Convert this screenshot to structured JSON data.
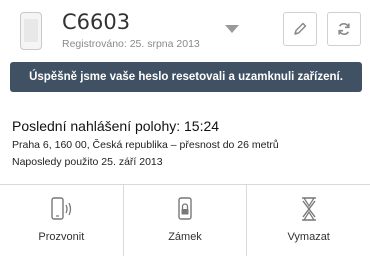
{
  "device": {
    "name": "C6603",
    "registered": "Registrováno: 25. srpna 2013"
  },
  "icons": {
    "device": "phone-thumbnail-icon",
    "dropdown": "chevron-down-icon",
    "edit": "pencil-icon",
    "refresh": "refresh-icon",
    "ring": "phone-ring-icon",
    "lock": "phone-lock-icon",
    "wipe": "phone-wipe-icon"
  },
  "banner": {
    "text": "Úspěšně jsme vaše heslo resetovali a uzamknuli zařízení.",
    "color": "#3f5163"
  },
  "location": {
    "title": "Poslední nahlášení polohy: 15:24",
    "address": "Praha 6, 160 00, Česká republika – přesnost do 26 metrů",
    "last_used": "Naposledy použito 25. září 2013"
  },
  "actions": [
    {
      "label": "Prozvonit"
    },
    {
      "label": "Zámek"
    },
    {
      "label": "Vymazat"
    }
  ]
}
